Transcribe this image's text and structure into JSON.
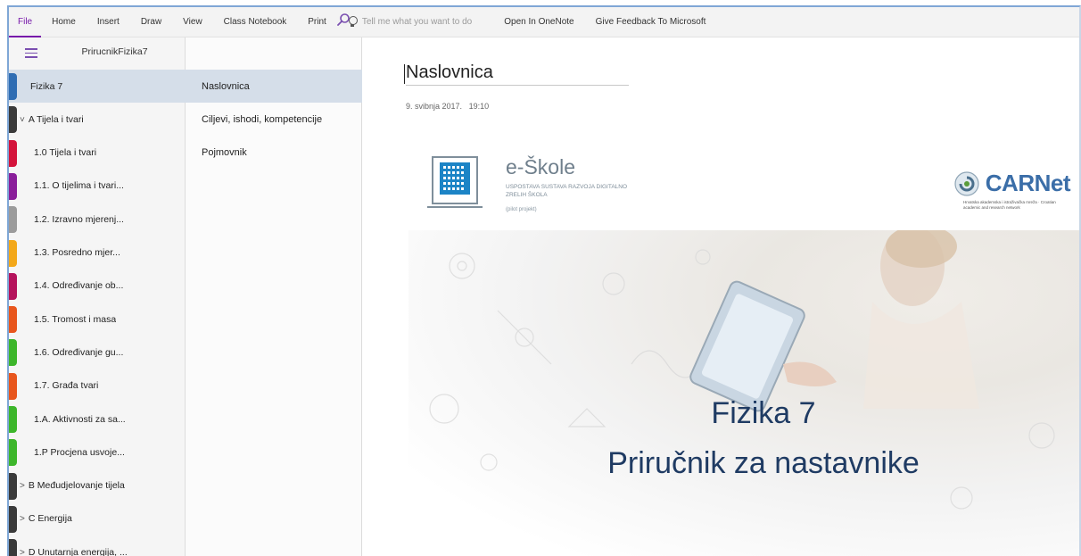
{
  "menubar": {
    "items": [
      "File",
      "Home",
      "Insert",
      "Draw",
      "View",
      "Class Notebook",
      "Print"
    ],
    "tellme_placeholder": "Tell me what you want to do",
    "right_items": [
      "Open In OneNote",
      "Give Feedback To Microsoft"
    ]
  },
  "notebook": {
    "title": "PrirucnikFizika7"
  },
  "sections": [
    {
      "label": "Fizika 7",
      "color": "#2f6db3",
      "selected": true,
      "indent": 0,
      "chevron": ""
    },
    {
      "label": "A Tijela i tvari",
      "color": "#3a3a3a",
      "selected": false,
      "indent": 0,
      "chevron": "˅"
    },
    {
      "label": "1.0 Tijela i tvari",
      "color": "#d4143b",
      "selected": false,
      "indent": 1,
      "chevron": ""
    },
    {
      "label": "1.1. O tijelima i tvari...",
      "color": "#8a1e9a",
      "selected": false,
      "indent": 1,
      "chevron": ""
    },
    {
      "label": "1.2. Izravno mjerenj...",
      "color": "#9b9b9b",
      "selected": false,
      "indent": 1,
      "chevron": ""
    },
    {
      "label": "1.3. Posredno mjer...",
      "color": "#f3a81a",
      "selected": false,
      "indent": 1,
      "chevron": ""
    },
    {
      "label": "1.4. Određivanje ob...",
      "color": "#b5135c",
      "selected": false,
      "indent": 1,
      "chevron": ""
    },
    {
      "label": "1.5. Tromost i masa",
      "color": "#e8561d",
      "selected": false,
      "indent": 1,
      "chevron": ""
    },
    {
      "label": "1.6. Određivanje gu...",
      "color": "#3db62b",
      "selected": false,
      "indent": 1,
      "chevron": ""
    },
    {
      "label": "1.7. Građa tvari",
      "color": "#e8561d",
      "selected": false,
      "indent": 1,
      "chevron": ""
    },
    {
      "label": "1.A. Aktivnosti za sa...",
      "color": "#3db62b",
      "selected": false,
      "indent": 1,
      "chevron": ""
    },
    {
      "label": "1.P Procjena usvoje...",
      "color": "#3db62b",
      "selected": false,
      "indent": 1,
      "chevron": ""
    },
    {
      "label": "B Međudjelovanje tijela",
      "color": "#3a3a3a",
      "selected": false,
      "indent": 0,
      "chevron": ">"
    },
    {
      "label": "C Energija",
      "color": "#3a3a3a",
      "selected": false,
      "indent": 0,
      "chevron": ">"
    },
    {
      "label": "D Unutarnja energija, ...",
      "color": "#3a3a3a",
      "selected": false,
      "indent": 0,
      "chevron": ">"
    }
  ],
  "pages": [
    {
      "label": "Naslovnica",
      "selected": true
    },
    {
      "label": "Ciljevi, ishodi, kompetencije",
      "selected": false
    },
    {
      "label": "Pojmovnik",
      "selected": false
    }
  ],
  "page": {
    "title": "Naslovnica",
    "date": "9. svibnja 2017.",
    "time": "19:10",
    "eskole_name": "e-Škole",
    "eskole_subtitle": "Uspostava sustava razvoja digitalno zrelih škola",
    "eskole_note": "(pilot projekt)",
    "carnet_name": "CARNet",
    "carnet_subtitle": "Hrvatska akademska i istraživačka mreža · Croatian academic and research network",
    "hero_title": "Fizika 7",
    "hero_subtitle": "Priručnik za nastavnike"
  },
  "colors": {
    "accent": "#7719aa",
    "selection": "#d5dee9",
    "hero_text": "#1f3b63",
    "carnet_blue": "#3b6ea8"
  }
}
